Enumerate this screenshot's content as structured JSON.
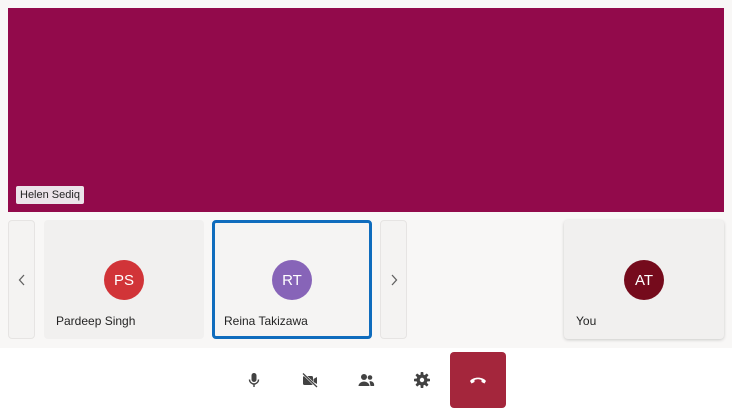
{
  "stage": {
    "participant_name": "Helen Sediq",
    "background_color": "#920a4b"
  },
  "strip": {
    "prev_icon": "chevron-left-icon",
    "next_icon": "chevron-right-icon",
    "participants": [
      {
        "initials": "PS",
        "name": "Pardeep Singh",
        "avatar_color": "#d13438",
        "selected": false
      },
      {
        "initials": "RT",
        "name": "Reina Takizawa",
        "avatar_color": "#8764b8",
        "selected": true
      }
    ],
    "self": {
      "initials": "AT",
      "name": "You",
      "avatar_color": "#750b1c"
    }
  },
  "controls": {
    "buttons": [
      {
        "name": "microphone-button",
        "icon": "microphone-icon"
      },
      {
        "name": "camera-button",
        "icon": "video-off-icon"
      },
      {
        "name": "participants-button",
        "icon": "people-icon"
      },
      {
        "name": "settings-button",
        "icon": "gear-icon"
      }
    ],
    "hangup": {
      "icon": "phone-hangup-icon",
      "color": "#a4263c"
    }
  }
}
